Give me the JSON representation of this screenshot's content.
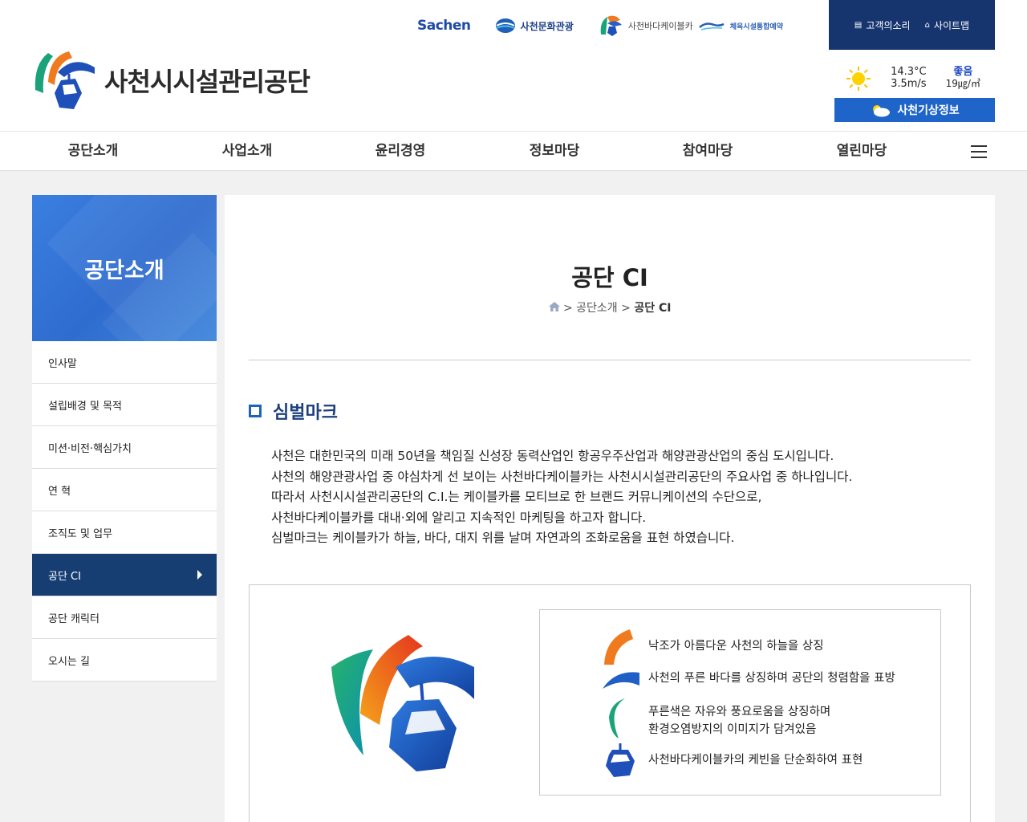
{
  "header": {
    "family_links": {
      "sachen": "Sachen",
      "culture": "사천문화관광",
      "cable": "사천바다케이블카",
      "sports": "체육시설통합예약"
    },
    "util": {
      "voice": "고객의소리",
      "sitemap": "사이트맵"
    },
    "logo_text": "사천시시설관리공단",
    "weather": {
      "temp": "14.3°C",
      "wind": "3.5m/s",
      "air_status": "좋음",
      "air_value": "19㎍/㎥",
      "button": "사천기상정보"
    }
  },
  "gnb": {
    "items": [
      "공단소개",
      "사업소개",
      "윤리경영",
      "정보마당",
      "참여마당",
      "열린마당"
    ]
  },
  "lnb": {
    "title": "공단소개",
    "items": [
      "인사말",
      "설립배경 및 목적",
      "미션·비전·핵심가치",
      "연 혁",
      "조직도 및 업무",
      "공단 CI",
      "공단 캐릭터",
      "오시는 길"
    ],
    "active_index": 5
  },
  "content": {
    "title": "공단 CI",
    "breadcrumb": {
      "sep": ">",
      "parent": "공단소개",
      "current": "공단 CI"
    },
    "section_title": "심벌마크",
    "description": [
      "사천은 대한민국의 미래 50년을 책임질 신성장 동력산업인 항공우주산업과 해양관광산업의 중심 도시입니다.",
      "사천의 해양관광사업 중 야심차게 선 보이는 사천바다케이블카는 사천시시설관리공단의 주요사업 중 하나입니다.",
      "따라서 사천시시설관리공단의 C.I.는 케이블카를 모티브로 한 브랜드 커뮤니케이션의 수단으로,",
      "사천바다케이블카를 대내·외에 알리고 지속적인 마케팅을 하고자 합니다.",
      "심벌마크는 케이블카가 하늘, 바다, 대지 위를 날며 자연과의 조화로움을 표현 하였습니다."
    ],
    "legend": [
      "낙조가 아름다운 사천의 하늘을 상징",
      "사천의 푸른 바다를 상징하며 공단의 청렴함을 표방",
      "푸른색은 자유와 풍요로움을 상징하며",
      "환경오염방지의 이미지가 담겨있음",
      "사천바다케이블카의 케빈을 단순화하여 표현"
    ]
  },
  "colors": {
    "primary_navy": "#16356f",
    "active_navy": "#163e73",
    "accent_blue": "#1f65c9",
    "orange": "#f07a1e",
    "green": "#1aa37a"
  }
}
